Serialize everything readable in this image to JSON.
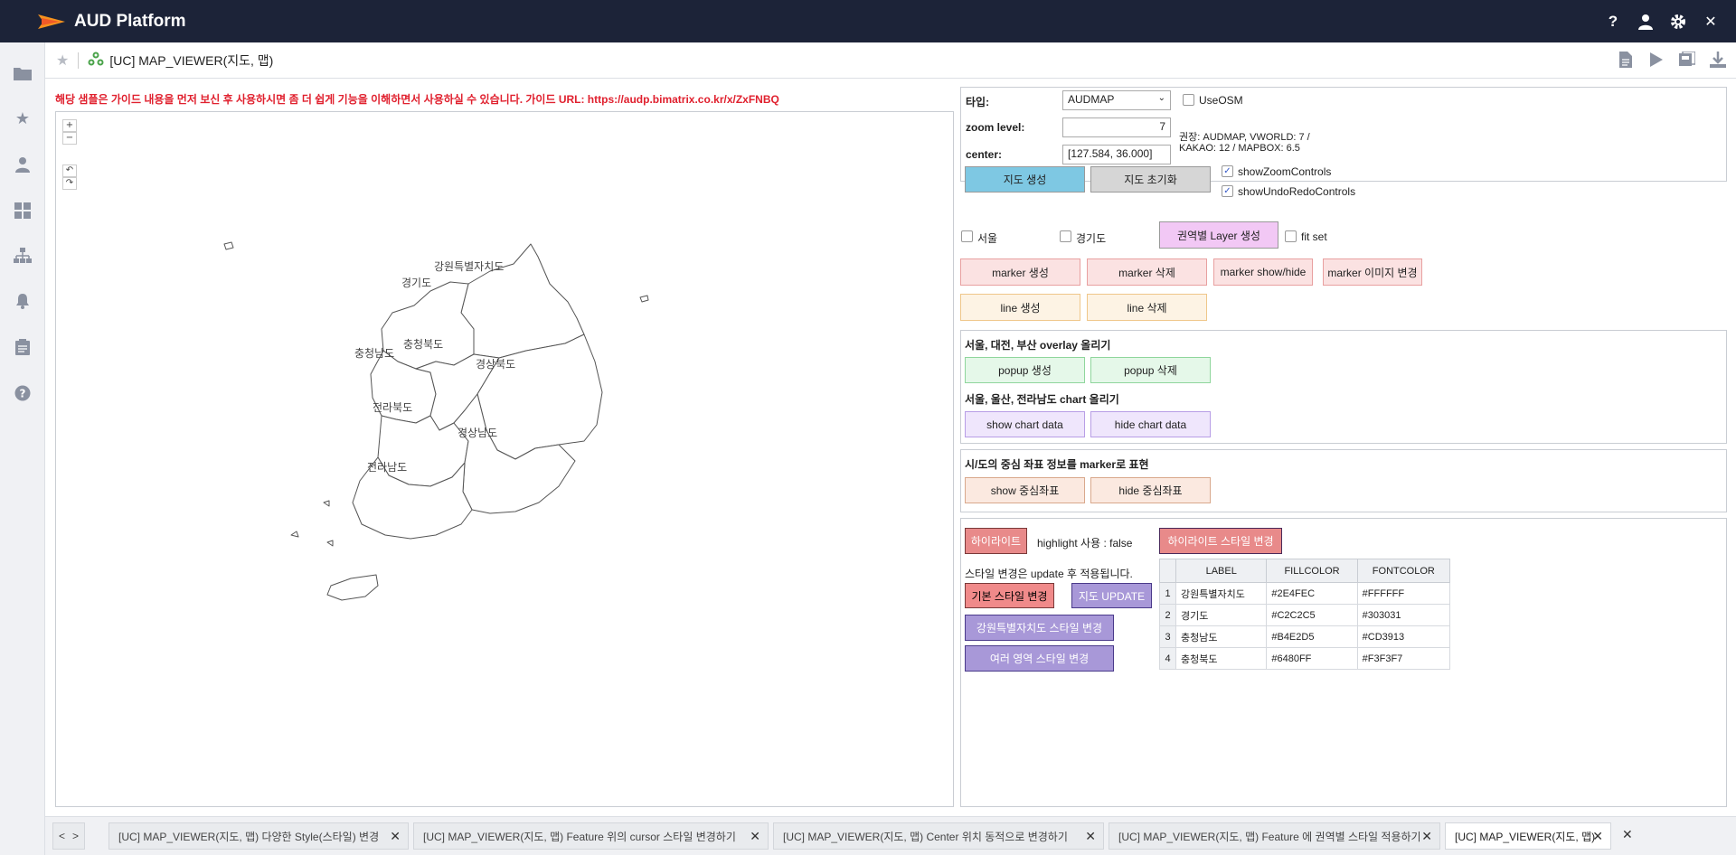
{
  "app": {
    "name": "AUD Platform"
  },
  "header": {
    "icons": [
      "help-icon",
      "user-icon",
      "gear-icon",
      "close-icon"
    ]
  },
  "nav": {
    "icons": [
      "folder-icon",
      "star-icon",
      "user-icon",
      "dashboard-icon",
      "sitemap-icon",
      "bell-icon",
      "clipboard-icon",
      "help-icon"
    ]
  },
  "page": {
    "title": "[UC] MAP_VIEWER(지도, 맵)"
  },
  "guide": {
    "text": "해당 샘플은 가이드 내용을 먼저 보신 후 사용하시면 좀 더 쉽게 기능을 이해하면서 사용하실 수 있습니다. 가이드 URL: https://audp.bimatrix.co.kr/x/ZxFNBQ"
  },
  "map": {
    "zoom_in": "+",
    "zoom_out": "−",
    "undo": "↶",
    "redo": "↷",
    "regions": [
      "강원특별자치도",
      "경기도",
      "충청북도",
      "충청남도",
      "경상북도",
      "전라북도",
      "경상남도",
      "전라남도"
    ]
  },
  "settings": {
    "type_label": "타입:",
    "type_value": "AUDMAP",
    "use_osm": "UseOSM",
    "zoom_label": "zoom level:",
    "zoom_value": "7",
    "center_label": "center:",
    "center_value": "[127.584, 36.000]",
    "recommend_line1": "권장: AUDMAP, VWORLD: 7 /",
    "recommend_line2": "KAKAO: 12 / MAPBOX: 6.5",
    "create_map": "지도 생성",
    "reset_map": "지도 초기화",
    "show_zoom": "showZoomControls",
    "show_undo": "showUndoRedoControls"
  },
  "layers": {
    "seoul": "서울",
    "gyeonggi": "경기도",
    "create_layer": "권역별 Layer 생성",
    "fit_set": "fit set"
  },
  "markers": {
    "create": "marker 생성",
    "delete": "marker 삭제",
    "toggle": "marker show/hide",
    "change_image": "marker 이미지 변경",
    "line_create": "line 생성",
    "line_delete": "line 삭제"
  },
  "overlay": {
    "heading": "서울, 대전, 부산 overlay 올리기",
    "popup_create": "popup 생성",
    "popup_delete": "popup 삭제",
    "chart_heading": "서울, 울산, 전라남도 chart 올리기",
    "show_chart": "show chart data",
    "hide_chart": "hide chart data"
  },
  "centers": {
    "heading": "시/도의 중심 좌표 정보를 marker로 표현",
    "show": "show 중심좌표",
    "hide": "hide 중심좌표"
  },
  "highlight": {
    "button": "하이라이트",
    "status": "highlight 사용 : false",
    "style_change": "하이라이트 스타일 변경",
    "note": "스타일 변경은 update 후 적용됩니다.",
    "basic_style": "기본 스타일 변경",
    "update": "지도 UPDATE",
    "gangwon_style": "강원특별자치도 스타일 변경",
    "multi_style": "여러 영역 스타일 변경"
  },
  "grid": {
    "headers": [
      "LABEL",
      "FILLCOLOR",
      "FONTCOLOR"
    ],
    "rows": [
      {
        "n": "1",
        "label": "강원특별자치도",
        "fill": "#2E4FEC",
        "font": "#FFFFFF"
      },
      {
        "n": "2",
        "label": "경기도",
        "fill": "#C2C2C5",
        "font": "#303031"
      },
      {
        "n": "3",
        "label": "충청남도",
        "fill": "#B4E2D5",
        "font": "#CD3913"
      },
      {
        "n": "4",
        "label": "충청북도",
        "fill": "#6480FF",
        "font": "#F3F3F7"
      }
    ]
  },
  "tabs": [
    {
      "label": "[UC] MAP_VIEWER(지도, 맵) 다양한 Style(스타일) 변경"
    },
    {
      "label": "[UC] MAP_VIEWER(지도, 맵) Feature 위의 cursor 스타일 변경하기"
    },
    {
      "label": "[UC] MAP_VIEWER(지도, 맵) Center 위치 동적으로 변경하기"
    },
    {
      "label": "[UC] MAP_VIEWER(지도, 맵) Feature 에 권역별 스타일 적용하기"
    },
    {
      "label": "[UC] MAP_VIEWER(지도, 맵)"
    }
  ],
  "tab_nav": {
    "prev": "<",
    "next": ">",
    "close_all": "✕"
  },
  "colors": {
    "topbar": "#1c2338",
    "accent_blue": "#7ec8e3",
    "guide_red": "#e0202e"
  }
}
